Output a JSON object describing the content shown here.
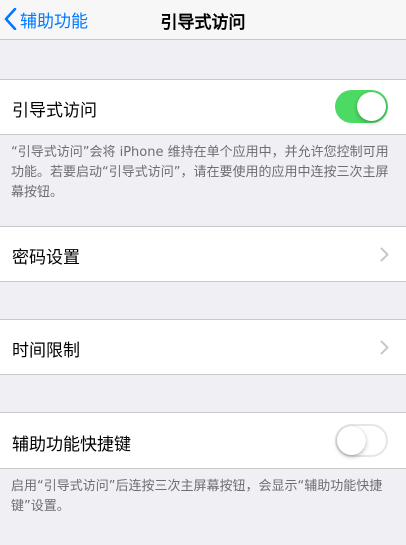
{
  "nav": {
    "back_label": "辅助功能",
    "title": "引导式访问"
  },
  "guided_access": {
    "label": "引导式访问",
    "enabled": true,
    "footer": "“引导式访问”会将 iPhone 维持在单个应用中，并允许您控制可用功能。若要启动“引导式访问”，请在要使用的应用中连按三次主屏幕按钮。"
  },
  "passcode_settings": {
    "label": "密码设置"
  },
  "time_limits": {
    "label": "时间限制"
  },
  "accessibility_shortcut": {
    "label": "辅助功能快捷键",
    "enabled": false,
    "footer": "启用“引导式访问”后连按三次主屏幕按钮，会显示“辅助功能快捷键”设置。"
  },
  "colors": {
    "accent": "#007aff",
    "toggle_on": "#4cd964",
    "background": "#efeff4",
    "footer_text": "#6d6d72"
  },
  "icons": {
    "back": "chevron-left-icon",
    "disclosure": "chevron-right-icon"
  }
}
